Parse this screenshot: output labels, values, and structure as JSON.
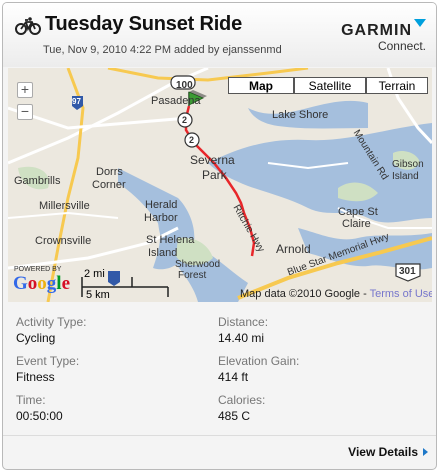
{
  "header": {
    "title": "Tuesday Sunset Ride",
    "subtitle": "Tue, Nov 9, 2010 4:22 PM added by ejanssenmd",
    "logo_text": "GARMIN",
    "logo_sub": "Connect.",
    "icon": "bicycle-icon"
  },
  "map": {
    "type_buttons": [
      "Map",
      "Satellite",
      "Terrain"
    ],
    "selected_type": "Map",
    "zoom_in": "+",
    "zoom_out": "−",
    "powered_by": "POWERED BY",
    "google": "Google",
    "scale_mi": "2 mi",
    "scale_km": "5 km",
    "attribution": "Map data ©2010 Google - ",
    "terms": "Terms of Use",
    "labels": {
      "pasadena": "Pasadena",
      "severna": "Severna",
      "park": "Park",
      "lake_shore": "Lake Shore",
      "gambrills": "Gambrills",
      "dorrs": "Dorrs",
      "corner": "Corner",
      "millersville": "Millersville",
      "herald": "Herald",
      "harbor": "Harbor",
      "crownsville": "Crownsville",
      "st_helena": "St Helena",
      "island": "Island",
      "sherwood": "Sherwood",
      "forest": "Forest",
      "arnold": "Arnold",
      "cape_st": "Cape St",
      "claire": "Claire",
      "gibson": "Gibson",
      "island2": "Island",
      "mountain_rd": "Mountain Rd",
      "ritchie_hwy": "Ritchie Hwy",
      "blue_star": "Blue Star Memorial Hwy",
      "shield_100": "100",
      "shield_97": "97",
      "shield_301": "301",
      "shield_2": "2"
    }
  },
  "stats": {
    "activity_type_label": "Activity Type:",
    "activity_type": "Cycling",
    "distance_label": "Distance:",
    "distance": "14.40 mi",
    "event_type_label": "Event Type:",
    "event_type": "Fitness",
    "elevation_label": "Elevation Gain:",
    "elevation": "414 ft",
    "time_label": "Time:",
    "time": "00:50:00",
    "calories_label": "Calories:",
    "calories": "485 C"
  },
  "footer": {
    "view_details": "View Details"
  },
  "colors": {
    "route": "#e8262a",
    "water": "#a5bfdd",
    "highway": "#f7c950",
    "accent": "#1e78c8"
  }
}
